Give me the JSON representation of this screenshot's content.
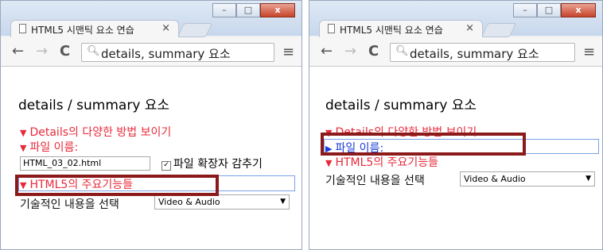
{
  "browser": {
    "tab_title": "HTML5 시맨틱 요소 연습",
    "tab_close": "×",
    "url": "details, summary 요소",
    "window_controls": {
      "minimize": "–",
      "maximize": "□",
      "close": "x"
    },
    "nav": {
      "back": "←",
      "forward": "→",
      "reload": "C",
      "menu": "≡"
    }
  },
  "page": {
    "title": "details / summary 요소",
    "summaries": [
      "Details의 다양한 방법 보이기",
      "파일 이름:",
      "HTML5의 주요기능들"
    ],
    "file_input_value": "HTML_03_02.html",
    "checkbox_label": "파일 확장자 감추기",
    "checkbox_mark": "✓",
    "select_label": "기술적인 내용을 선택",
    "select_value": "Video & Audio",
    "select_arrow": "▼",
    "open_marker": "▼",
    "closed_marker": "▶"
  },
  "colors": {
    "open_summary": "#e8293a",
    "closed_summary": "#1a3bd8",
    "highlight_box": "#8b1a1a",
    "focus_outline": "#7aa2e8"
  },
  "icons": [
    "document-icon",
    "search-icon",
    "menu-icon",
    "back-arrow-icon",
    "forward-arrow-icon",
    "reload-icon"
  ]
}
